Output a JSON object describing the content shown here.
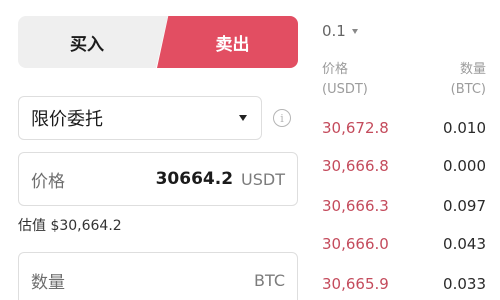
{
  "side_tabs": {
    "buy": "买入",
    "sell": "卖出"
  },
  "order_type": {
    "label": "限价委托",
    "caret": "chevron-down-icon",
    "info_icon": "i"
  },
  "price_field": {
    "label": "价格",
    "value": "30664.2",
    "unit": "USDT"
  },
  "estimate": "估值 $30,664.2",
  "quantity_field": {
    "placeholder": "数量",
    "unit": "BTC"
  },
  "order_book": {
    "depth": "0.1",
    "headers": {
      "price_line1": "价格",
      "price_line2": "(USDT)",
      "qty_line1": "数量",
      "qty_line2": "(BTC)"
    },
    "asks": [
      {
        "price": "30,672.8",
        "qty": "0.010"
      },
      {
        "price": "30,666.8",
        "qty": "0.000"
      },
      {
        "price": "30,666.3",
        "qty": "0.097"
      },
      {
        "price": "30,666.0",
        "qty": "0.043"
      },
      {
        "price": "30,665.9",
        "qty": "0.033"
      }
    ]
  },
  "colors": {
    "sell": "#e24e62",
    "ask_price": "#c44b5c",
    "buy_tab_bg": "#efefef"
  }
}
